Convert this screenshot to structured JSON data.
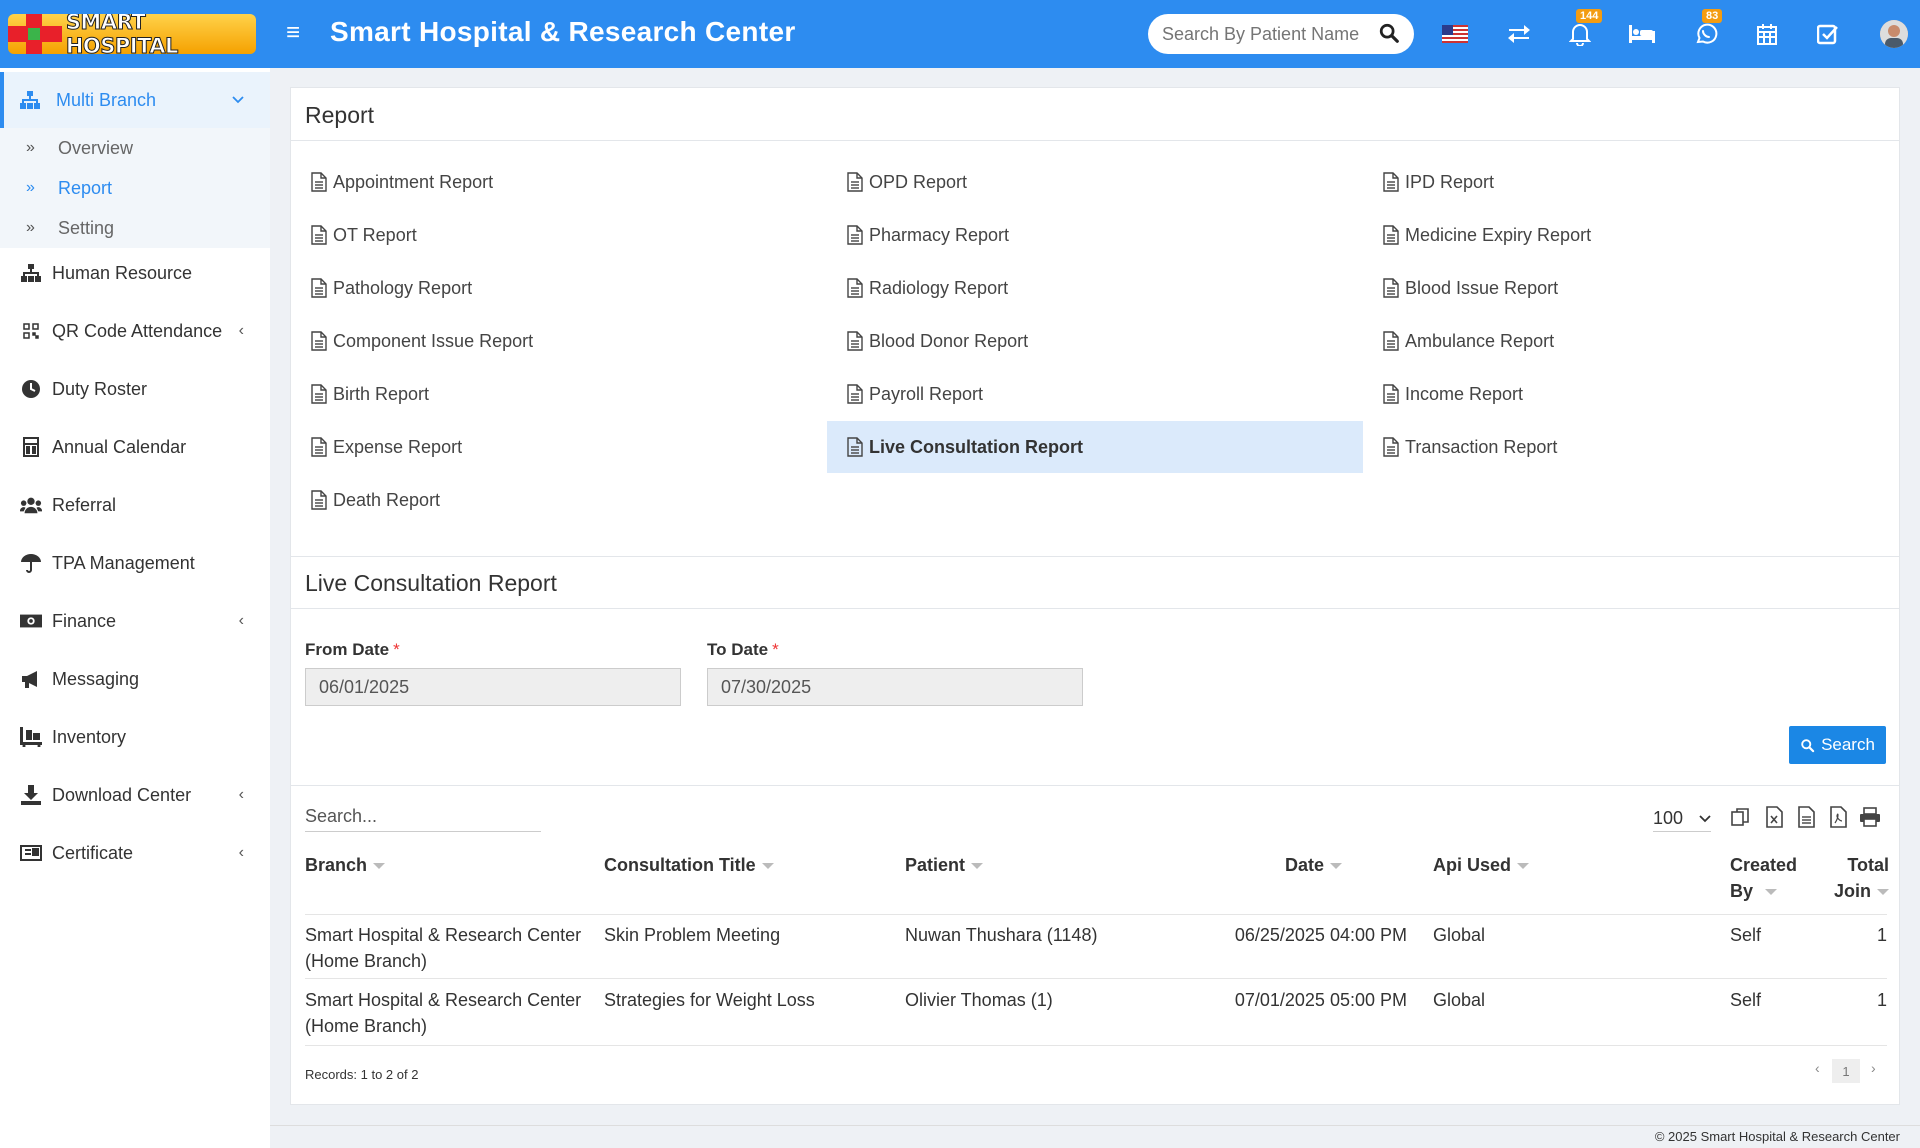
{
  "header": {
    "logo_text": "SMART HOSPITAL",
    "app_title": "Smart Hospital & Research Center",
    "search_placeholder": "Search By Patient Name",
    "notifications_count": "144",
    "whatsapp_count": "83"
  },
  "sidebar": {
    "multi_branch": "Multi Branch",
    "sub_items": [
      "Overview",
      "Report",
      "Setting"
    ],
    "items": [
      {
        "label": "Human Resource",
        "icon": "sitemap-icon"
      },
      {
        "label": "QR Code Attendance",
        "icon": "qrcode-icon"
      },
      {
        "label": "Duty Roster",
        "icon": "clock-icon"
      },
      {
        "label": "Annual Calendar",
        "icon": "calculator-icon"
      },
      {
        "label": "Referral",
        "icon": "users-icon"
      },
      {
        "label": "TPA Management",
        "icon": "umbrella-icon"
      },
      {
        "label": "Finance",
        "icon": "money-icon"
      },
      {
        "label": "Messaging",
        "icon": "bullhorn-icon"
      },
      {
        "label": "Inventory",
        "icon": "dolly-icon"
      },
      {
        "label": "Download Center",
        "icon": "download-icon"
      },
      {
        "label": "Certificate",
        "icon": "certificate-icon"
      }
    ]
  },
  "report": {
    "title": "Report",
    "links": [
      "Appointment Report",
      "OPD Report",
      "IPD Report",
      "OT Report",
      "Pharmacy Report",
      "Medicine Expiry Report",
      "Pathology Report",
      "Radiology Report",
      "Blood Issue Report",
      "Component Issue Report",
      "Blood Donor Report",
      "Ambulance Report",
      "Birth Report",
      "Payroll Report",
      "Income Report",
      "Expense Report",
      "Live Consultation Report",
      "Transaction Report",
      "Death Report"
    ]
  },
  "live": {
    "title": "Live Consultation Report",
    "from_label": "From Date",
    "to_label": "To Date",
    "from_value": "06/01/2025",
    "to_value": "07/30/2025",
    "search_button": "Search"
  },
  "table": {
    "search_placeholder": "Search...",
    "page_size": "100",
    "headers": {
      "branch": "Branch",
      "title": "Consultation Title",
      "patient": "Patient",
      "date": "Date",
      "api": "Api Used",
      "created_1": "Created",
      "created_2": "By",
      "total_1": "Total",
      "total_2": "Join"
    },
    "rows": [
      {
        "branch_1": "Smart Hospital & Research Center",
        "branch_2": "(Home Branch)",
        "title": "Skin Problem Meeting",
        "patient": "Nuwan Thushara (1148)",
        "date": "06/25/2025 04:00 PM",
        "api": "Global",
        "created": "Self",
        "total": "1"
      },
      {
        "branch_1": "Smart Hospital & Research Center",
        "branch_2": "(Home Branch)",
        "title": "Strategies for Weight Loss",
        "patient": "Olivier Thomas (1)",
        "date": "07/01/2025 05:00 PM",
        "api": "Global",
        "created": "Self",
        "total": "1"
      }
    ],
    "records": "Records: 1 to 2 of 2",
    "current_page": "1"
  },
  "footer": "© 2025 Smart Hospital & Research Center"
}
